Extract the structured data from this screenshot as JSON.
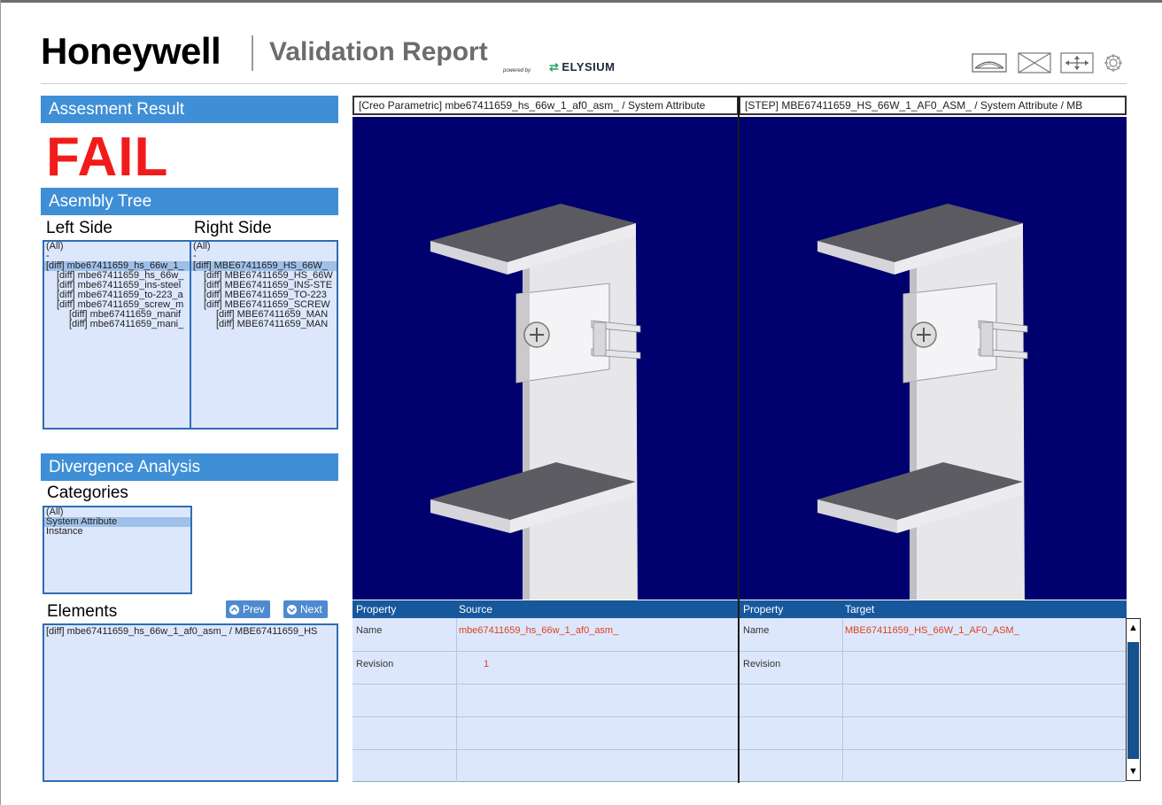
{
  "header": {
    "brand": "Honeywell",
    "title": "Validation Report",
    "powered_by": "powered by",
    "partner": "ELYSIUM"
  },
  "toolbar": {
    "icons": [
      "view-eye-icon",
      "clear-x-icon",
      "fit-arrows-icon",
      "settings-gear-icon"
    ]
  },
  "assessment": {
    "heading": "Assesment Result",
    "result": "FAIL",
    "result_color": "#f21b1b"
  },
  "assembly_tree": {
    "heading": "Asembly Tree",
    "left_label": "Left Side",
    "right_label": "Right Side",
    "left_items": [
      {
        "text": "(All)",
        "level": 0
      },
      {
        "text": "-",
        "level": 0
      },
      {
        "text": "[diff] mbe67411659_hs_66w_1_",
        "level": 0,
        "selected": true
      },
      {
        "text": "[diff] mbe67411659_hs_66w_",
        "level": 1
      },
      {
        "text": "[diff] mbe67411659_ins-steel",
        "level": 1
      },
      {
        "text": "[diff] mbe67411659_to-223_a",
        "level": 1
      },
      {
        "text": "[diff] mbe67411659_screw_m",
        "level": 1
      },
      {
        "text": "[diff] mbe67411659_manif",
        "level": 2
      },
      {
        "text": "[diff] mbe67411659_mani_",
        "level": 2
      }
    ],
    "right_items": [
      {
        "text": "(All)",
        "level": 0
      },
      {
        "text": "-",
        "level": 0
      },
      {
        "text": "[diff] MBE67411659_HS_66W_",
        "level": 0,
        "selected": true
      },
      {
        "text": "[diff] MBE67411659_HS_66W",
        "level": 1
      },
      {
        "text": "[diff] MBE67411659_INS-STE",
        "level": 1
      },
      {
        "text": "[diff] MBE67411659_TO-223",
        "level": 1
      },
      {
        "text": "[diff] MBE67411659_SCREW",
        "level": 1
      },
      {
        "text": "[diff] MBE67411659_MAN",
        "level": 2
      },
      {
        "text": "[diff] MBE67411659_MAN",
        "level": 2
      }
    ]
  },
  "divergence": {
    "heading": "Divergence Analysis",
    "categories_label": "Categories",
    "categories": [
      {
        "text": "(All)",
        "selected": false
      },
      {
        "text": "System Attribute",
        "selected": true
      },
      {
        "text": "Instance",
        "selected": false
      }
    ],
    "elements_label": "Elements",
    "prev_label": "Prev",
    "next_label": "Next",
    "elements": [
      "[diff] mbe67411659_hs_66w_1_af0_asm_ / MBE67411659_HS"
    ]
  },
  "viewer": {
    "left_title": "[Creo Parametric] mbe67411659_hs_66w_1_af0_asm_ / System Attribute",
    "right_title": "[STEP] MBE67411659_HS_66W_1_AF0_ASM_ / System Attribute / MB",
    "background": "#00006e"
  },
  "properties": {
    "left": {
      "col1": "Property",
      "col2": "Source",
      "rows": [
        {
          "property": "Name",
          "value": "mbe67411659_hs_66w_1_af0_asm_"
        },
        {
          "property": "Revision",
          "value": "1"
        },
        {
          "property": "",
          "value": ""
        },
        {
          "property": "",
          "value": ""
        },
        {
          "property": "",
          "value": ""
        }
      ]
    },
    "right": {
      "col1": "Property",
      "col2": "Target",
      "rows": [
        {
          "property": "Name",
          "value": "MBE67411659_HS_66W_1_AF0_ASM_"
        },
        {
          "property": "Revision",
          "value": ""
        },
        {
          "property": "",
          "value": ""
        },
        {
          "property": "",
          "value": ""
        },
        {
          "property": "",
          "value": ""
        }
      ]
    }
  }
}
